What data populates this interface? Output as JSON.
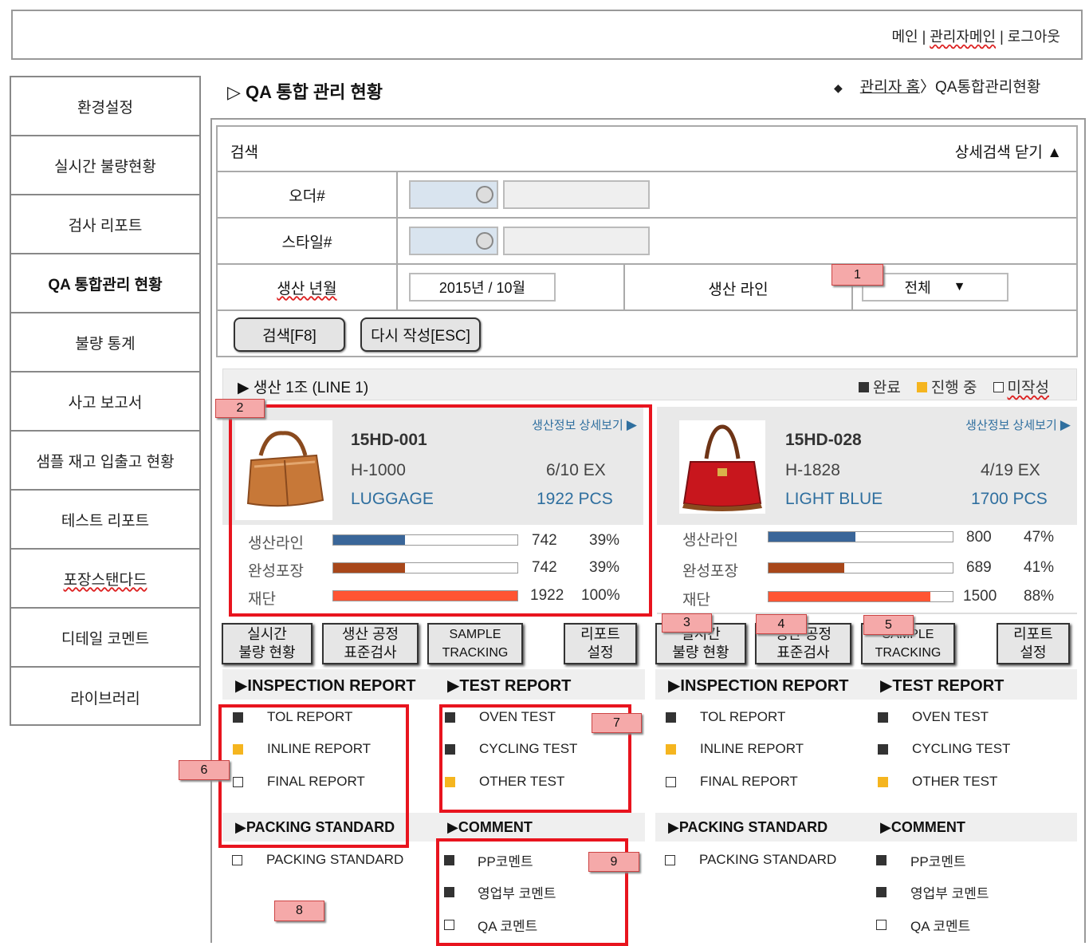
{
  "header": {
    "links": [
      "메인",
      "관리자메인",
      "로그아웃"
    ],
    "separator": " | "
  },
  "sidebar": {
    "items": [
      {
        "label": "환경설정"
      },
      {
        "label": "실시간 불량현황"
      },
      {
        "label": "검사 리포트"
      },
      {
        "label": "QA 통합관리 현황",
        "active": true
      },
      {
        "label": "불량 통계"
      },
      {
        "label": "사고 보고서"
      },
      {
        "label": "샘플 재고 입출고 현황"
      },
      {
        "label": "테스트 리포트"
      },
      {
        "label": "포장스탠다드"
      },
      {
        "label": "디테일 코멘트"
      },
      {
        "label": "라이브러리"
      }
    ]
  },
  "page": {
    "title": "▷ QA 통합 관리 현황",
    "breadcrumb": {
      "bullet": "◆",
      "home": "관리자 홈",
      "separator": "〉",
      "current": "QA통합관리현황"
    }
  },
  "search": {
    "title": "검색",
    "toggle_label": "상세검색 닫기 ▲",
    "order_label": "오더#",
    "style_label": "스타일#",
    "month_label": "생산 년월",
    "month_value": "2015년 / 10월",
    "line_label": "생산 라인",
    "line_value": "전체",
    "line_arrow": "▼",
    "search_button": "검색[F8]",
    "reset_button": "다시 작성[ESC]"
  },
  "section": {
    "title": "▶ 생산 1조 (LINE 1)",
    "legend": [
      {
        "label": "완료",
        "color": "#333333"
      },
      {
        "label": "진행 중",
        "color": "#f5b51f"
      },
      {
        "label": "미작성",
        "color": "#ffffff"
      }
    ]
  },
  "cards": [
    {
      "detail_link": "생산정보 상세보기",
      "code": "15HD-001",
      "line": "H-1000",
      "date": "6/10 EX",
      "color": "LUGGAGE",
      "qty": "1922 PCS",
      "image_icon": "tan-handbag-image",
      "stats": [
        {
          "label": "생산라인",
          "value": "742",
          "pct": "39%",
          "fraction": 0.39,
          "bar_color": "#3a6699"
        },
        {
          "label": "완성포장",
          "value": "742",
          "pct": "39%",
          "fraction": 0.39,
          "bar_color": "#a8471a"
        },
        {
          "label": "재단",
          "value": "1922",
          "pct": "100%",
          "fraction": 1.0,
          "bar_color": "#ff5533"
        }
      ],
      "buttons": [
        "실시간\n불량 현황",
        "생산 공정\n표준검사",
        "SAMPLE\nTRACKING",
        "리포트\n설정"
      ],
      "inspection": {
        "head": "▶INSPECTION REPORT",
        "items": [
          {
            "label": "TOL REPORT",
            "status": "black"
          },
          {
            "label": "INLINE REPORT",
            "status": "gold"
          },
          {
            "label": "FINAL REPORT",
            "status": "white"
          }
        ]
      },
      "test": {
        "head": "▶TEST REPORT",
        "items": [
          {
            "label": "OVEN TEST",
            "status": "black"
          },
          {
            "label": "CYCLING TEST",
            "status": "black"
          },
          {
            "label": "OTHER TEST",
            "status": "gold"
          }
        ]
      },
      "packing": {
        "head": "▶PACKING STANDARD",
        "items": [
          {
            "label": "PACKING STANDARD",
            "status": "white"
          }
        ]
      },
      "comment": {
        "head": "▶COMMENT",
        "items": [
          {
            "label": "PP코멘트",
            "status": "black"
          },
          {
            "label": "영업부 코멘트",
            "status": "black"
          },
          {
            "label": "QA 코멘트",
            "status": "white"
          }
        ]
      }
    },
    {
      "detail_link": "생산정보 상세보기",
      "code": "15HD-028",
      "line": "H-1828",
      "date": "4/19 EX",
      "color": "LIGHT BLUE",
      "qty": "1700 PCS",
      "image_icon": "red-handbag-image",
      "stats": [
        {
          "label": "생산라인",
          "value": "800",
          "pct": "47%",
          "fraction": 0.47,
          "bar_color": "#3a6699"
        },
        {
          "label": "완성포장",
          "value": "689",
          "pct": "41%",
          "fraction": 0.41,
          "bar_color": "#a8471a"
        },
        {
          "label": "재단",
          "value": "1500",
          "pct": "88%",
          "fraction": 0.88,
          "bar_color": "#ff5533"
        }
      ],
      "buttons": [
        "실시간\n불량 현황",
        "생산 공정\n표준검사",
        "SAMPLE\nTRACKING",
        "리포트\n설정"
      ],
      "inspection": {
        "head": "▶INSPECTION REPORT",
        "items": [
          {
            "label": "TOL REPORT",
            "status": "black"
          },
          {
            "label": "INLINE REPORT",
            "status": "gold"
          },
          {
            "label": "FINAL REPORT",
            "status": "white"
          }
        ]
      },
      "test": {
        "head": "▶TEST REPORT",
        "items": [
          {
            "label": "OVEN TEST",
            "status": "black"
          },
          {
            "label": "CYCLING TEST",
            "status": "black"
          },
          {
            "label": "OTHER TEST",
            "status": "gold"
          }
        ]
      },
      "packing": {
        "head": "▶PACKING STANDARD",
        "items": [
          {
            "label": "PACKING STANDARD",
            "status": "white"
          }
        ]
      },
      "comment": {
        "head": "▶COMMENT",
        "items": [
          {
            "label": "PP코멘트",
            "status": "black"
          },
          {
            "label": "영업부 코멘트",
            "status": "black"
          },
          {
            "label": "QA 코멘트",
            "status": "white"
          }
        ]
      }
    }
  ],
  "annotations": [
    "1",
    "2",
    "3",
    "4",
    "5",
    "6",
    "7",
    "8",
    "9"
  ]
}
